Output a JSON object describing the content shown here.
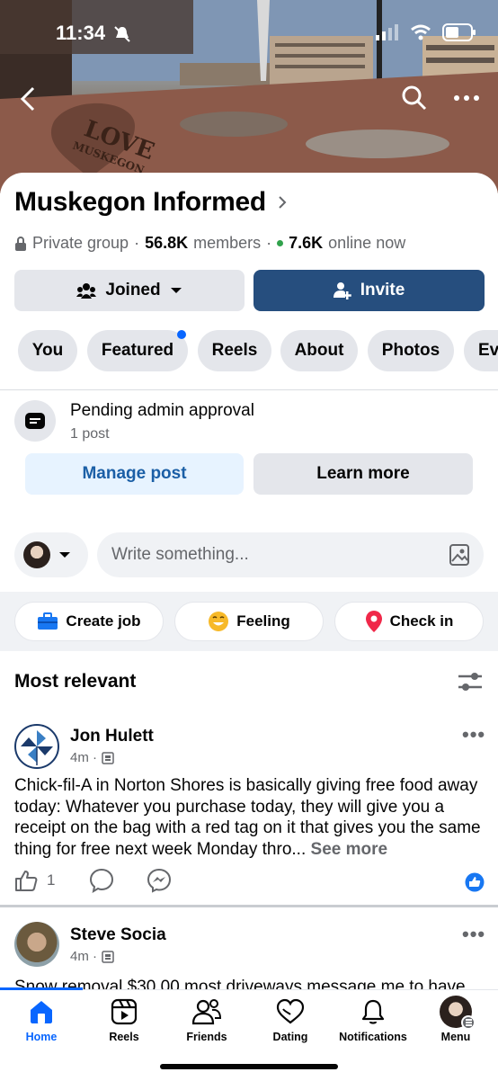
{
  "status": {
    "time": "11:34"
  },
  "group": {
    "name": "Muskegon Informed",
    "privacy": "Private group",
    "members_count": "56.8K",
    "members_label": "members",
    "online_count": "7.6K",
    "online_label": "online now"
  },
  "cover": {
    "sculpture_text_1": "LOVE",
    "sculpture_text_2": "MUSKEGON"
  },
  "actions": {
    "joined_label": "Joined",
    "invite_label": "Invite"
  },
  "tabs": [
    {
      "label": "You"
    },
    {
      "label": "Featured",
      "has_dot": true
    },
    {
      "label": "Reels"
    },
    {
      "label": "About"
    },
    {
      "label": "Photos"
    },
    {
      "label": "Ev"
    }
  ],
  "pending": {
    "title": "Pending admin approval",
    "subtitle": "1 post",
    "manage_label": "Manage post",
    "learn_label": "Learn more"
  },
  "composer": {
    "placeholder": "Write something..."
  },
  "quick_actions": [
    {
      "label": "Create job",
      "icon": "briefcase-icon"
    },
    {
      "label": "Feeling",
      "icon": "smiley-icon"
    },
    {
      "label": "Check in",
      "icon": "location-pin-icon"
    }
  ],
  "feed": {
    "sort_label": "Most relevant",
    "posts": [
      {
        "author": "Jon Hulett",
        "time": "4m ·",
        "body": "Chick-fil-A in Norton Shores is basically giving free food away today: Whatever you purchase today, they will give you a receipt on the bag with a red tag on it that gives you the same thing for free next week Monday thro...",
        "see_more": "See more",
        "like_count": "1"
      },
      {
        "author": "Steve Socia",
        "time": "4m ·",
        "body": "Snow removal $30.00 most driveways message me to have"
      }
    ]
  },
  "tabbar": [
    {
      "label": "Home",
      "icon": "home-icon",
      "active": true
    },
    {
      "label": "Reels",
      "icon": "reels-icon"
    },
    {
      "label": "Friends",
      "icon": "friends-icon"
    },
    {
      "label": "Dating",
      "icon": "dating-heart-icon"
    },
    {
      "label": "Notifications",
      "icon": "bell-icon"
    },
    {
      "label": "Menu",
      "icon": "profile-menu-icon"
    }
  ],
  "colors": {
    "accent": "#264e7e",
    "link": "#1b5fa6",
    "active_tab": "#0866ff",
    "online_dot": "#31a24c"
  }
}
